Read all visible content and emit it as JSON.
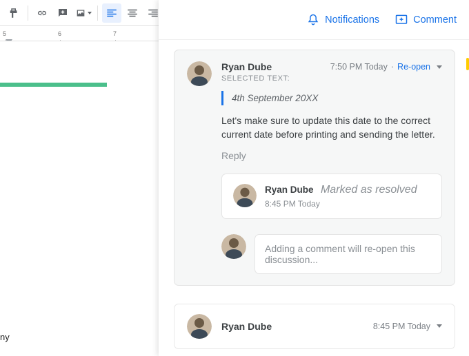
{
  "toolbar": {
    "icons": {
      "paint": "paint-format",
      "link": "insert-link",
      "comment_box": "add-comment-inline",
      "image": "insert-image",
      "align_left": "align-left",
      "align_center": "align-center",
      "align_right": "align-right"
    }
  },
  "ruler": {
    "visible_numbers": [
      "5",
      "6",
      "7"
    ],
    "indent_marker_at": 24
  },
  "document": {
    "footer_fragment": "ny"
  },
  "panel": {
    "actions": {
      "notifications": "Notifications",
      "comment": "Comment"
    }
  },
  "threads": [
    {
      "author": "Ryan Dube",
      "timestamp": "7:50 PM Today",
      "action_label": "Re-open",
      "selected_text_label": "SELECTED TEXT:",
      "quoted_text": "4th September 20XX",
      "body": "Let's make sure to update this date to the correct current date before printing and sending the letter.",
      "reply_label": "Reply",
      "resolution": {
        "author": "Ryan Dube",
        "status": "Marked as resolved",
        "timestamp": "8:45 PM Today"
      },
      "reply_placeholder": "Adding a comment will re-open this discussion..."
    },
    {
      "author": "Ryan Dube",
      "timestamp": "8:45 PM Today"
    }
  ]
}
